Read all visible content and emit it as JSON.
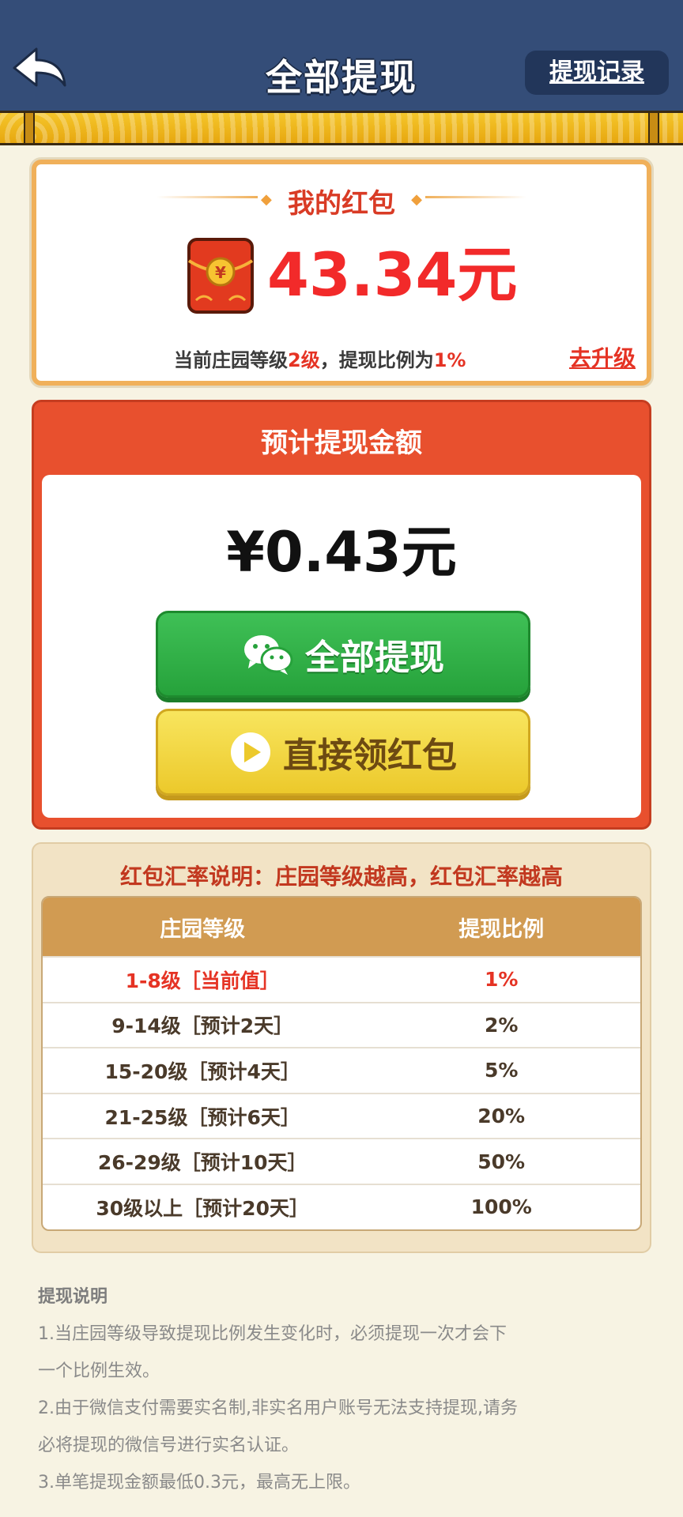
{
  "header": {
    "title": "全部提现",
    "history_label": "提现记录"
  },
  "wallet": {
    "title": "我的红包",
    "amount": "43.34元",
    "level_prefix": "当前庄园等级",
    "level_value": "2级",
    "level_mid": "，提现比例为",
    "rate_value": "1%",
    "upgrade_label": "去升级"
  },
  "estimate": {
    "title": "预计提现金额",
    "amount": "¥0.43元",
    "withdraw_all_label": "全部提现",
    "claim_label": "直接领红包"
  },
  "rates": {
    "title": "红包汇率说明：庄园等级越高，红包汇率越高",
    "headers": [
      "庄园等级",
      "提现比例"
    ],
    "rows": [
      {
        "level": "1-8级［当前值］",
        "rate": "1%"
      },
      {
        "level": "9-14级［预计2天］",
        "rate": "2%"
      },
      {
        "level": "15-20级［预计4天］",
        "rate": "5%"
      },
      {
        "level": "21-25级［预计6天］",
        "rate": "20%"
      },
      {
        "level": "26-29级［预计10天］",
        "rate": "50%"
      },
      {
        "level": "30级以上［预计20天］",
        "rate": "100%"
      }
    ]
  },
  "notes": {
    "title": "提现说明",
    "lines": [
      "1.当庄园等级导致提现比例发生变化时，必须提现一次才会下",
      "一个比例生效。",
      "2.由于微信支付需要实名制,非实名用户账号无法支持提现,请务",
      "必将提现的微信号进行实名认证。",
      "3.单笔提现金额最低0.3元，最高无上限。"
    ]
  },
  "colors": {
    "header_bg": "#344d78",
    "accent_red": "#e53324",
    "card_orange": "#e8502e",
    "green_button": "#26a23b",
    "yellow_button": "#ecc92b"
  },
  "icons": [
    "back-arrow-icon",
    "red-packet-icon",
    "wechat-icon",
    "play-icon"
  ]
}
